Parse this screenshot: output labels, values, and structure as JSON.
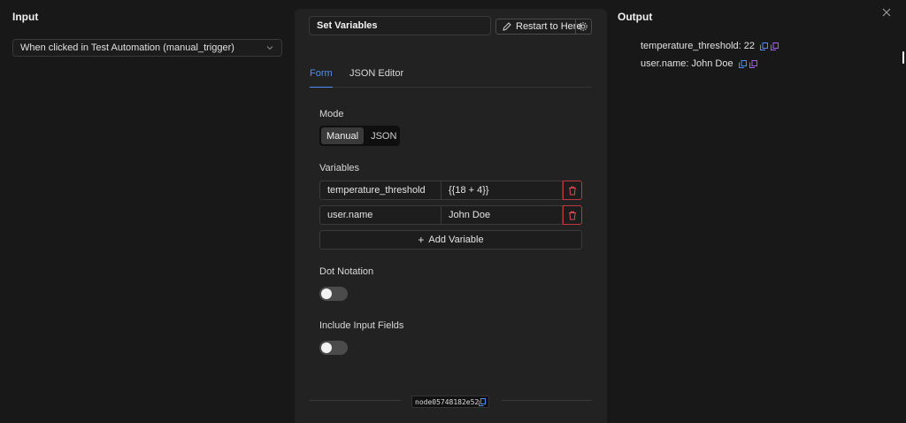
{
  "input_panel": {
    "title": "Input",
    "source_select": "When clicked in Test Automation (manual_trigger)"
  },
  "node": {
    "name": "Set Variables",
    "restart_label": "Restart to Here",
    "tabs": [
      {
        "label": "Form",
        "active": true
      },
      {
        "label": "JSON Editor",
        "active": false
      }
    ],
    "mode_label": "Mode",
    "mode_options": [
      {
        "label": "Manual",
        "selected": true
      },
      {
        "label": "JSON",
        "selected": false
      }
    ],
    "variables_label": "Variables",
    "variables": [
      {
        "name": "temperature_threshold",
        "value": "{{18 + 4}}"
      },
      {
        "name": "user.name",
        "value": "John Doe"
      }
    ],
    "add_variable_label": "Add Variable",
    "dot_notation_label": "Dot Notation",
    "dot_notation_on": false,
    "include_input_label": "Include Input Fields",
    "include_input_on": false,
    "node_id": "node05748182e52"
  },
  "output_panel": {
    "title": "Output",
    "items": [
      {
        "text": "temperature_threshold: 22"
      },
      {
        "text": "user.name: John Doe"
      }
    ]
  },
  "colors": {
    "accent": "#4d8ef7",
    "danger": "#c0383f",
    "copy_icon_blue": "#4d8ef7",
    "copy_icon_purple": "#a35ef0"
  }
}
